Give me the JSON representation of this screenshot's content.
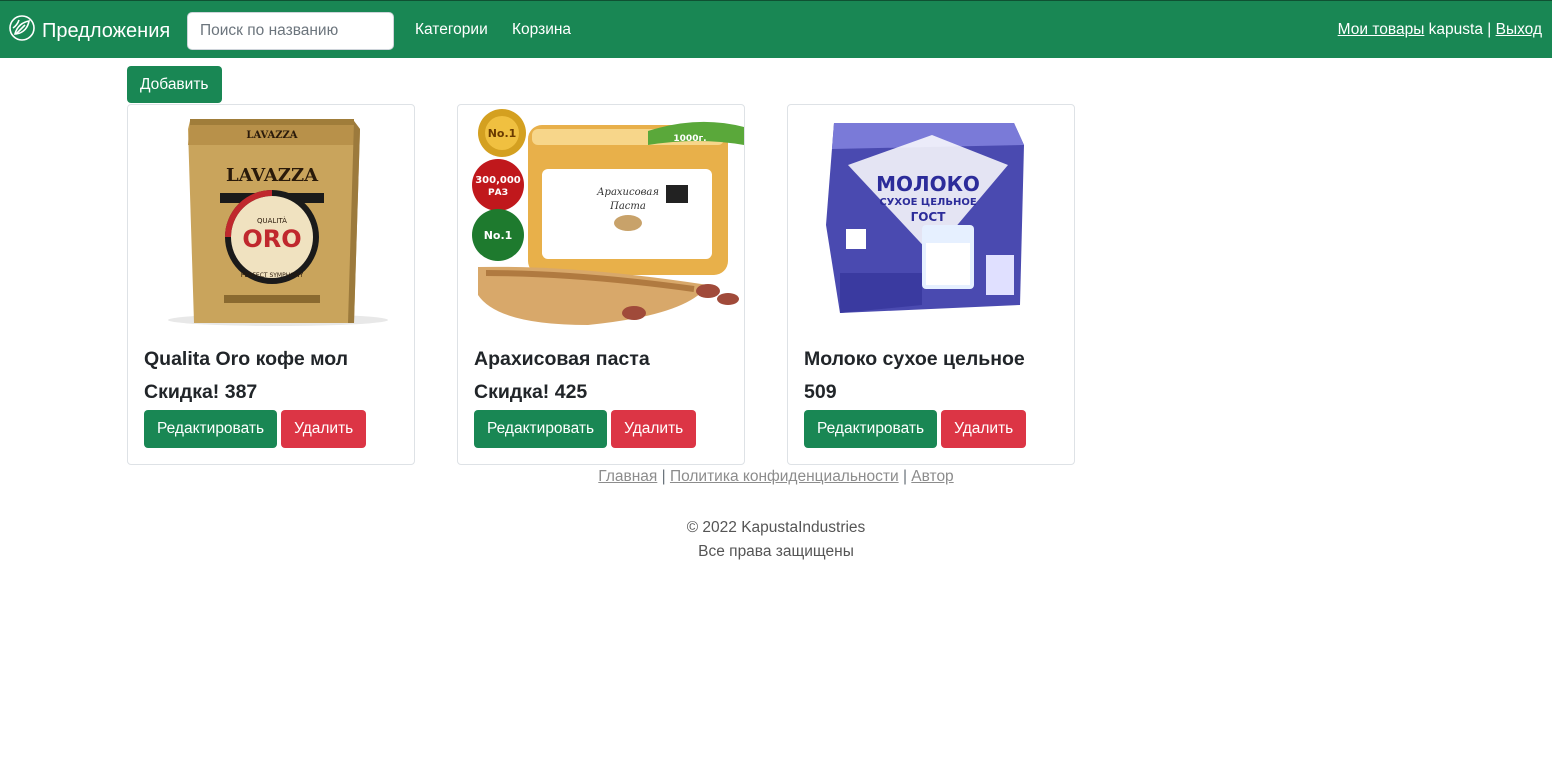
{
  "navbar": {
    "brand": "Предложения",
    "brand_icon": "leaf-logo-icon",
    "search_placeholder": "Поиск по названию",
    "links": [
      "Категории",
      "Корзина"
    ],
    "my_items": "Мои товары",
    "username": "kapusta",
    "separator": "|",
    "logout": "Выход",
    "color": "#198754"
  },
  "add_button": "Добавить",
  "products": [
    {
      "title": "Qualita Oro кофе мол",
      "price": "Скидка! 387",
      "image": "lavazza-coffee-pack-image",
      "edit": "Редактировать",
      "delete": "Удалить"
    },
    {
      "title": "Арахисовая паста",
      "price": "Скидка! 425",
      "image": "peanut-butter-jar-image",
      "edit": "Редактировать",
      "delete": "Удалить"
    },
    {
      "title": "Молоко сухое цельное",
      "price": "509",
      "image": "dry-milk-pack-image",
      "edit": "Редактировать",
      "delete": "Удалить"
    }
  ],
  "footer": {
    "links": [
      "Главная",
      "Политика конфиденциальности",
      "Автор"
    ],
    "copyright": "© 2022 KapustaIndustries",
    "rights": "Все права защищены"
  },
  "colors": {
    "success": "#198754",
    "danger": "#dc3545"
  }
}
